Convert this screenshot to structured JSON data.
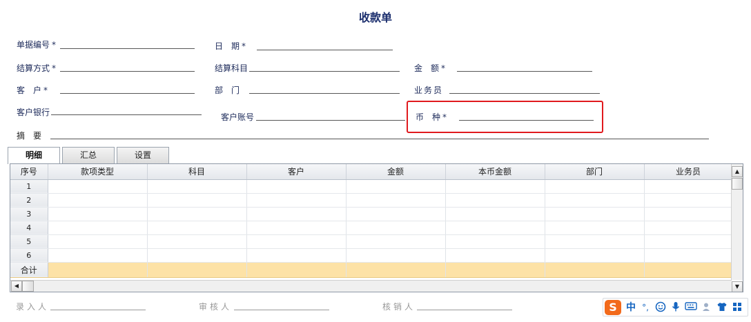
{
  "title": "收款单",
  "form": {
    "doc_no": "单据编号",
    "date": "日　期",
    "settle_method": "结算方式",
    "settle_account": "结算科目",
    "amount": "金　额",
    "customer": "客　户",
    "department": "部　门",
    "salesman": "业务员",
    "customer_bank": "客户银行",
    "customer_account": "客户账号",
    "currency": "币　种",
    "summary": "摘　要",
    "required_mark": "*"
  },
  "tabs": [
    "明细",
    "汇总",
    "设置"
  ],
  "grid": {
    "columns": [
      "序号",
      "款项类型",
      "科目",
      "客户",
      "金额",
      "本币金额",
      "部门",
      "业务员"
    ],
    "rows": [
      "1",
      "2",
      "3",
      "4",
      "5",
      "6"
    ],
    "total_label": "合计"
  },
  "footer": {
    "entered_by": "录入人",
    "reviewed_by": "审核人",
    "verified_by": "核销人"
  },
  "ime": {
    "logo": "S",
    "mode": "中",
    "punct": "°,"
  },
  "colors": {
    "highlight_border": "#e0191d",
    "total_row": "#fde2a6",
    "label_text": "#1c2a5a"
  }
}
